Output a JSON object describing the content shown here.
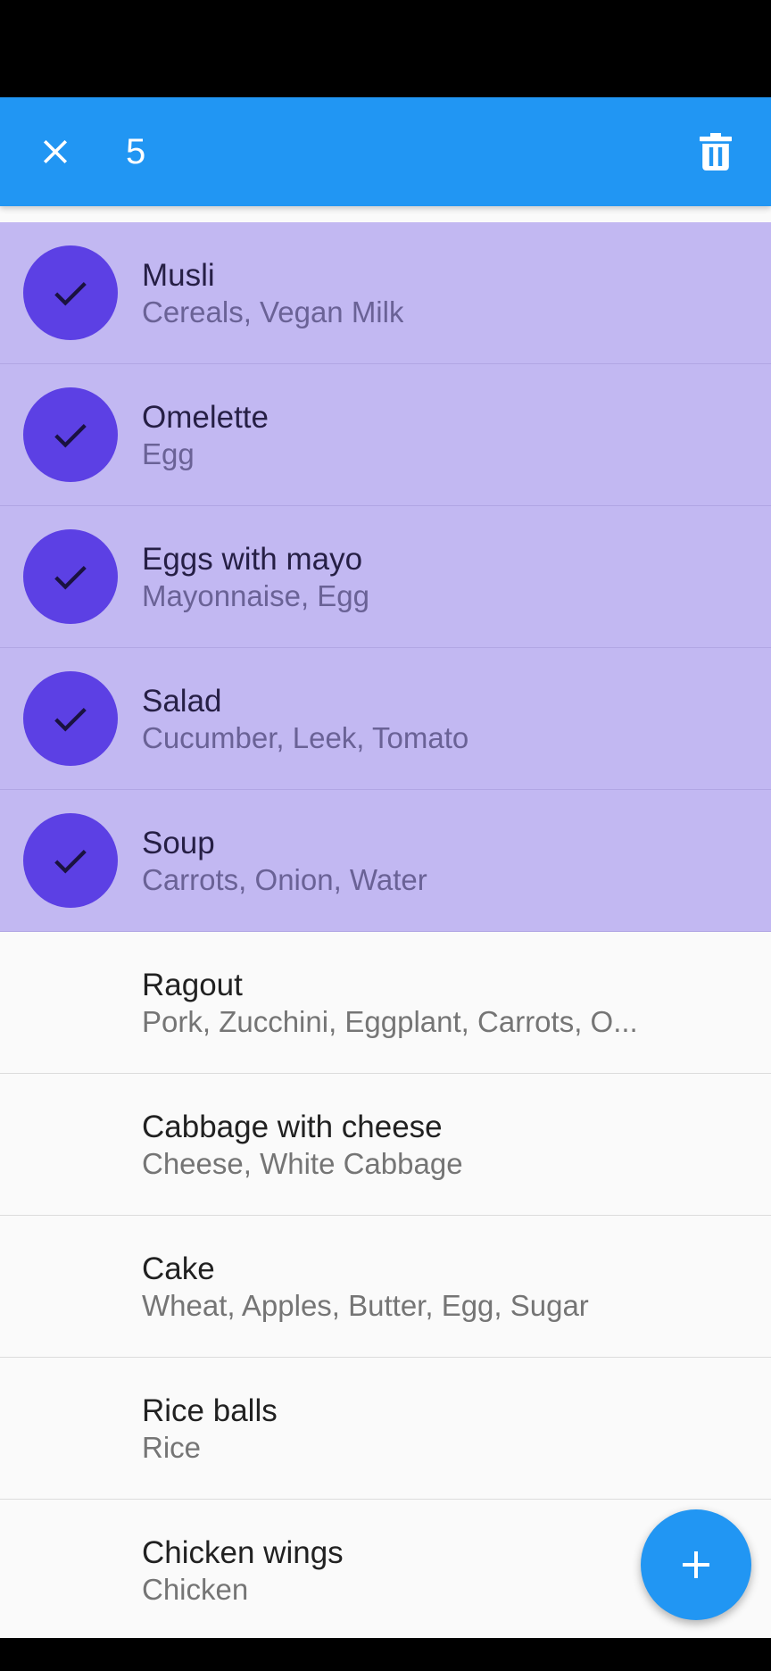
{
  "app_bar": {
    "selected_count": "5",
    "close_icon": "close-icon",
    "delete_icon": "trash-icon"
  },
  "items": [
    {
      "title": "Musli",
      "subtitle": "Cereals, Vegan Milk",
      "selected": true
    },
    {
      "title": "Omelette",
      "subtitle": "Egg",
      "selected": true
    },
    {
      "title": "Eggs with mayo",
      "subtitle": "Mayonnaise, Egg",
      "selected": true
    },
    {
      "title": "Salad",
      "subtitle": "Cucumber, Leek, Tomato",
      "selected": true
    },
    {
      "title": "Soup",
      "subtitle": "Carrots, Onion, Water",
      "selected": true
    },
    {
      "title": "Ragout",
      "subtitle": "Pork, Zucchini, Eggplant, Carrots, O...",
      "selected": false
    },
    {
      "title": "Cabbage with cheese",
      "subtitle": "Cheese, White Cabbage",
      "selected": false
    },
    {
      "title": "Cake",
      "subtitle": "Wheat, Apples, Butter, Egg, Sugar",
      "selected": false
    },
    {
      "title": "Rice balls",
      "subtitle": "Rice",
      "selected": false
    },
    {
      "title": "Chicken wings",
      "subtitle": "Chicken",
      "selected": false
    }
  ],
  "fab": {
    "icon": "plus-icon"
  },
  "colors": {
    "app_bar": "#2196f3",
    "selected_row": "#c2b8f2",
    "check_circle": "#5c40e4",
    "fab": "#2196f3"
  }
}
